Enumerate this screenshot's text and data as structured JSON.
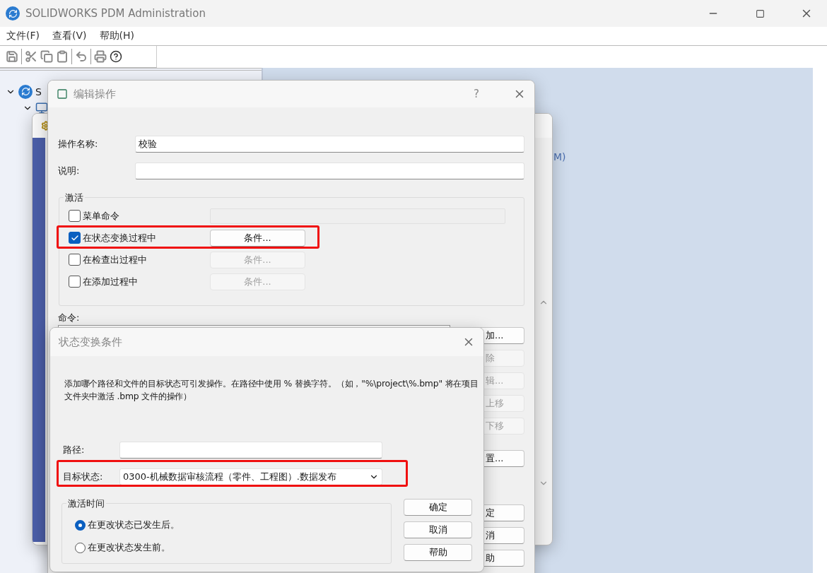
{
  "window": {
    "title": "SOLIDWORKS PDM Administration"
  },
  "menu": [
    {
      "label": "文件(F)"
    },
    {
      "label": "查看(V)"
    },
    {
      "label": "帮助(H)"
    }
  ],
  "toolbar": [
    {
      "kind": "save",
      "disabled": true
    },
    {
      "kind": "cut",
      "disabled": true
    },
    {
      "kind": "copy",
      "disabled": true
    },
    {
      "kind": "paste",
      "disabled": true
    },
    {
      "kind": "undo",
      "disabled": true
    },
    {
      "kind": "print",
      "disabled": true
    },
    {
      "kind": "help",
      "disabled": false
    }
  ],
  "tree": {
    "label": "S",
    "expanded": true,
    "children": [
      {
        "expanded": true
      }
    ]
  },
  "background_text": "M)",
  "edit_dialog": {
    "title": "编辑操作",
    "help": "?",
    "fields": [
      {
        "label": "操作名称:",
        "value": "校验"
      },
      {
        "label": "说明:"
      }
    ],
    "activation": {
      "title": "激活",
      "options": [
        {
          "kind": "field",
          "label": "菜单命令",
          "checked": false
        },
        {
          "kind": "button",
          "label": "在状态变换过程中",
          "checked": true,
          "highlighted": true,
          "button": {
            "label": "条件...",
            "disabled": false
          }
        },
        {
          "kind": "button",
          "label": "在检查出过程中",
          "checked": false,
          "button": {
            "label": "条件...",
            "disabled": true
          }
        },
        {
          "kind": "button",
          "label": "在添加过程中",
          "checked": false,
          "button": {
            "label": "条件...",
            "disabled": true
          }
        }
      ]
    },
    "commands_label": "命令:",
    "side_button_groups": [
      [
        {
          "label": "加...",
          "disabled": false
        },
        {
          "label": "除",
          "disabled": true
        },
        {
          "label": "辑...",
          "disabled": true
        },
        {
          "label": "上移",
          "disabled": true
        },
        {
          "label": "下移",
          "disabled": true
        }
      ],
      [
        {
          "label": "置...",
          "disabled": false
        }
      ],
      [
        {
          "label": "定",
          "disabled": false
        },
        {
          "label": "消",
          "disabled": false
        },
        {
          "label": "助",
          "disabled": false
        }
      ]
    ]
  },
  "condition_dialog": {
    "title": "状态变换条件",
    "description": "添加哪个路径和文件的目标状态可引发操作。在路径中使用 % 替换字符。（如，\"%\\project\\%.bmp\" 将在项目文件夹中激活 .bmp 文件的操作）",
    "path": {
      "label": "路径:"
    },
    "target_state": {
      "label": "目标状态:",
      "value": "0300-机械数据审核流程（零件、工程图）.数据发布",
      "highlighted": true
    },
    "timing": {
      "title": "激活时间",
      "options": [
        {
          "label": "在更改状态已发生后。",
          "selected": true
        },
        {
          "label": "在更改状态发生前。",
          "selected": false
        }
      ]
    },
    "buttons": [
      {
        "label": "确定"
      },
      {
        "label": "取消"
      },
      {
        "label": "帮助"
      }
    ]
  }
}
